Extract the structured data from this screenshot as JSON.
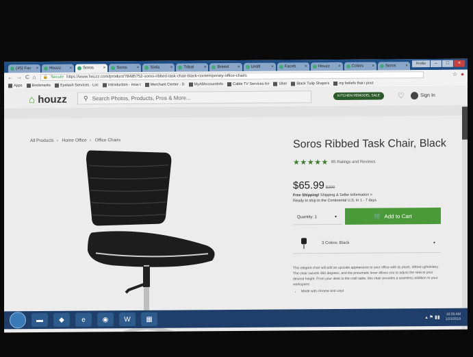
{
  "browser": {
    "tabs": [
      {
        "label": "(45) Fac"
      },
      {
        "label": "Houzz"
      },
      {
        "label": "Soros"
      },
      {
        "label": "Soros"
      },
      {
        "label": "Sinfa"
      },
      {
        "label": "Tribal"
      },
      {
        "label": "Bristol"
      },
      {
        "label": "Untitl"
      },
      {
        "label": "Faceb"
      },
      {
        "label": "Houzz"
      },
      {
        "label": "Colors"
      },
      {
        "label": "Soros"
      }
    ],
    "profile_label": "Profile",
    "secure_label": "Secure",
    "url": "https://www.houzz.com/product/78485752-soros-ribbed-task-chair-black-contemporary-office-chairs",
    "bookmarks": [
      "Apps",
      "Bookmarks",
      "Eyelash Services - Loc",
      "Introduction - How t",
      "Merchant Center - D",
      "MyAllAccountInfo",
      "Cable TV Services for",
      "Uber",
      "Black Tulip Shape's",
      "my beliefs that i post"
    ]
  },
  "header": {
    "logo": "houzz",
    "search_placeholder": "Search Photos, Products, Pros & More...",
    "sale_badge": "KITCHEN REMODEL SALE",
    "sign_in": "Sign In"
  },
  "breadcrumb": [
    "All Products",
    "Home Office",
    "Office Chairs"
  ],
  "product": {
    "title": "Soros Ribbed Task Chair, Black",
    "stars": "★★★★★",
    "rating_text": "65 Ratings and Reviews",
    "price": "$65.99",
    "old_price": "$200",
    "shipping_bold": "Free Shipping!",
    "shipping_rest": "Shipping & Seller Information >",
    "ship_time": "Ready to ship to the Continental U.S. in 1 - 7 days",
    "quantity_label": "Quantity: 1",
    "add_to_cart": "Add to Cart",
    "color_label": "3 Colors: Black",
    "description": "This elegant chair will add an upscale appearance to your office with its plush, ribbed upholstery. The chair swivels 360 degrees, and the pneumatic lever allows you to adjust the seat to your desired height. From your desk to the craft table, this chair provides a seamless addition to your workspace.",
    "bullet_1": "Made with chrome and vinyl"
  },
  "taskbar": {
    "time": "10:30 AM",
    "date": "1/23/2018"
  }
}
